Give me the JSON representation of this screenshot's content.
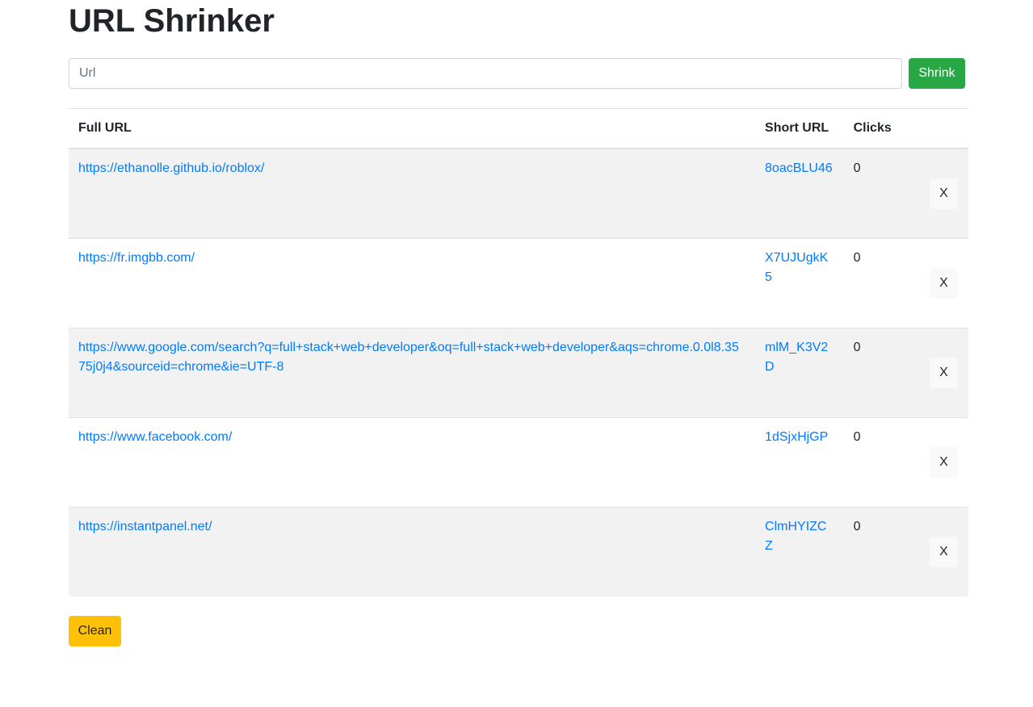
{
  "page": {
    "title": "URL Shrinker"
  },
  "form": {
    "url_placeholder": "Url",
    "url_value": "",
    "shrink_label": "Shrink"
  },
  "table": {
    "headers": {
      "full_url": "Full URL",
      "short_url": "Short URL",
      "clicks": "Clicks"
    },
    "rows": [
      {
        "full": "https://ethanolle.github.io/roblox/",
        "short": "8oacBLU46",
        "clicks": "0",
        "delete_label": "X"
      },
      {
        "full": "https://fr.imgbb.com/",
        "short": "X7UJUgkK5",
        "clicks": "0",
        "delete_label": "X"
      },
      {
        "full": "https://www.google.com/search?q=full+stack+web+developer&oq=full+stack+web+developer&aqs=chrome.0.0l8.3575j0j4&sourceid=chrome&ie=UTF-8",
        "short": "mlM_K3V2D",
        "clicks": "0",
        "delete_label": "X"
      },
      {
        "full": "https://www.facebook.com/",
        "short": "1dSjxHjGP",
        "clicks": "0",
        "delete_label": "X"
      },
      {
        "full": "https://instantpanel.net/",
        "short": "ClmHYIZCZ",
        "clicks": "0",
        "delete_label": "X"
      }
    ]
  },
  "actions": {
    "clean_label": "Clean"
  },
  "colors": {
    "primary_link": "#007bff",
    "success": "#28a745",
    "warning": "#ffc107",
    "light": "#f8f9fa",
    "striped_row": "#f2f2f2"
  }
}
